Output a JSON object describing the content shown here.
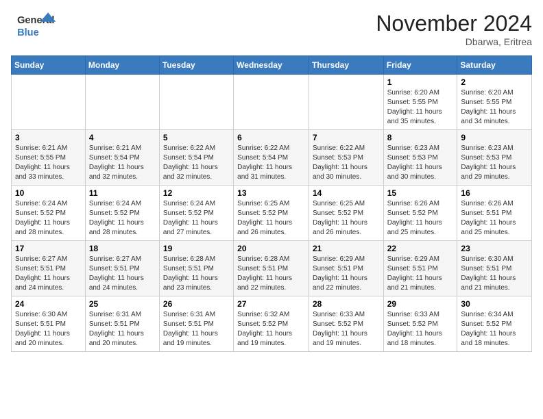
{
  "logo": {
    "line1": "General",
    "line2": "Blue"
  },
  "header": {
    "month": "November 2024",
    "location": "Dbarwa, Eritrea"
  },
  "weekdays": [
    "Sunday",
    "Monday",
    "Tuesday",
    "Wednesday",
    "Thursday",
    "Friday",
    "Saturday"
  ],
  "weeks": [
    [
      {
        "day": "",
        "info": ""
      },
      {
        "day": "",
        "info": ""
      },
      {
        "day": "",
        "info": ""
      },
      {
        "day": "",
        "info": ""
      },
      {
        "day": "",
        "info": ""
      },
      {
        "day": "1",
        "info": "Sunrise: 6:20 AM\nSunset: 5:55 PM\nDaylight: 11 hours and 35 minutes."
      },
      {
        "day": "2",
        "info": "Sunrise: 6:20 AM\nSunset: 5:55 PM\nDaylight: 11 hours and 34 minutes."
      }
    ],
    [
      {
        "day": "3",
        "info": "Sunrise: 6:21 AM\nSunset: 5:55 PM\nDaylight: 11 hours and 33 minutes."
      },
      {
        "day": "4",
        "info": "Sunrise: 6:21 AM\nSunset: 5:54 PM\nDaylight: 11 hours and 32 minutes."
      },
      {
        "day": "5",
        "info": "Sunrise: 6:22 AM\nSunset: 5:54 PM\nDaylight: 11 hours and 32 minutes."
      },
      {
        "day": "6",
        "info": "Sunrise: 6:22 AM\nSunset: 5:54 PM\nDaylight: 11 hours and 31 minutes."
      },
      {
        "day": "7",
        "info": "Sunrise: 6:22 AM\nSunset: 5:53 PM\nDaylight: 11 hours and 30 minutes."
      },
      {
        "day": "8",
        "info": "Sunrise: 6:23 AM\nSunset: 5:53 PM\nDaylight: 11 hours and 30 minutes."
      },
      {
        "day": "9",
        "info": "Sunrise: 6:23 AM\nSunset: 5:53 PM\nDaylight: 11 hours and 29 minutes."
      }
    ],
    [
      {
        "day": "10",
        "info": "Sunrise: 6:24 AM\nSunset: 5:52 PM\nDaylight: 11 hours and 28 minutes."
      },
      {
        "day": "11",
        "info": "Sunrise: 6:24 AM\nSunset: 5:52 PM\nDaylight: 11 hours and 28 minutes."
      },
      {
        "day": "12",
        "info": "Sunrise: 6:24 AM\nSunset: 5:52 PM\nDaylight: 11 hours and 27 minutes."
      },
      {
        "day": "13",
        "info": "Sunrise: 6:25 AM\nSunset: 5:52 PM\nDaylight: 11 hours and 26 minutes."
      },
      {
        "day": "14",
        "info": "Sunrise: 6:25 AM\nSunset: 5:52 PM\nDaylight: 11 hours and 26 minutes."
      },
      {
        "day": "15",
        "info": "Sunrise: 6:26 AM\nSunset: 5:52 PM\nDaylight: 11 hours and 25 minutes."
      },
      {
        "day": "16",
        "info": "Sunrise: 6:26 AM\nSunset: 5:51 PM\nDaylight: 11 hours and 25 minutes."
      }
    ],
    [
      {
        "day": "17",
        "info": "Sunrise: 6:27 AM\nSunset: 5:51 PM\nDaylight: 11 hours and 24 minutes."
      },
      {
        "day": "18",
        "info": "Sunrise: 6:27 AM\nSunset: 5:51 PM\nDaylight: 11 hours and 24 minutes."
      },
      {
        "day": "19",
        "info": "Sunrise: 6:28 AM\nSunset: 5:51 PM\nDaylight: 11 hours and 23 minutes."
      },
      {
        "day": "20",
        "info": "Sunrise: 6:28 AM\nSunset: 5:51 PM\nDaylight: 11 hours and 22 minutes."
      },
      {
        "day": "21",
        "info": "Sunrise: 6:29 AM\nSunset: 5:51 PM\nDaylight: 11 hours and 22 minutes."
      },
      {
        "day": "22",
        "info": "Sunrise: 6:29 AM\nSunset: 5:51 PM\nDaylight: 11 hours and 21 minutes."
      },
      {
        "day": "23",
        "info": "Sunrise: 6:30 AM\nSunset: 5:51 PM\nDaylight: 11 hours and 21 minutes."
      }
    ],
    [
      {
        "day": "24",
        "info": "Sunrise: 6:30 AM\nSunset: 5:51 PM\nDaylight: 11 hours and 20 minutes."
      },
      {
        "day": "25",
        "info": "Sunrise: 6:31 AM\nSunset: 5:51 PM\nDaylight: 11 hours and 20 minutes."
      },
      {
        "day": "26",
        "info": "Sunrise: 6:31 AM\nSunset: 5:51 PM\nDaylight: 11 hours and 19 minutes."
      },
      {
        "day": "27",
        "info": "Sunrise: 6:32 AM\nSunset: 5:52 PM\nDaylight: 11 hours and 19 minutes."
      },
      {
        "day": "28",
        "info": "Sunrise: 6:33 AM\nSunset: 5:52 PM\nDaylight: 11 hours and 19 minutes."
      },
      {
        "day": "29",
        "info": "Sunrise: 6:33 AM\nSunset: 5:52 PM\nDaylight: 11 hours and 18 minutes."
      },
      {
        "day": "30",
        "info": "Sunrise: 6:34 AM\nSunset: 5:52 PM\nDaylight: 11 hours and 18 minutes."
      }
    ]
  ]
}
